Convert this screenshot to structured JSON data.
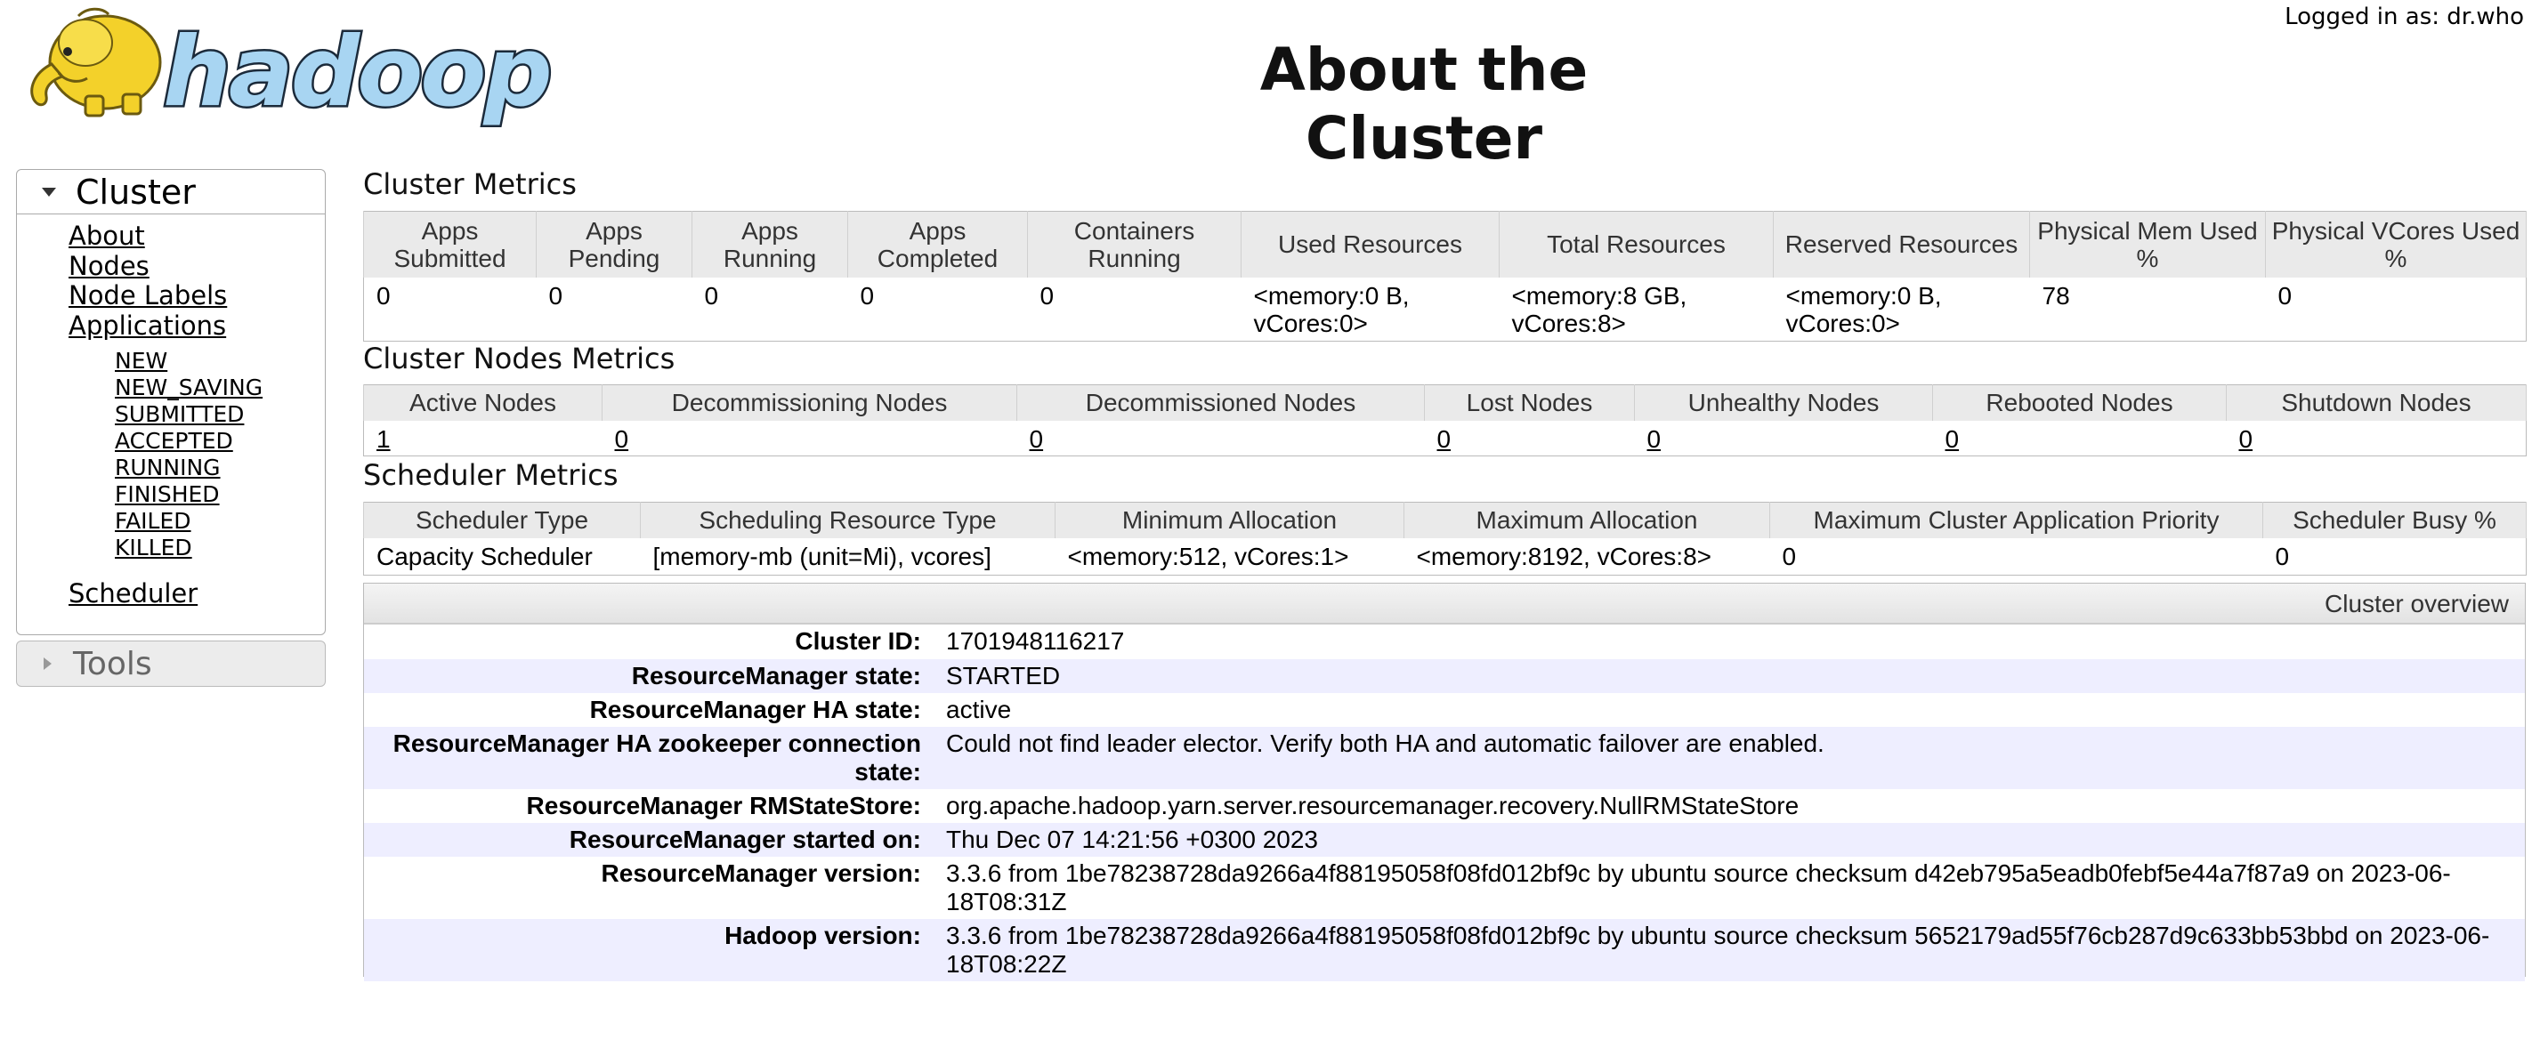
{
  "header": {
    "login_text": "Logged in as: dr.who",
    "page_title": "About the Cluster",
    "logo_text": "hadoop"
  },
  "sidebar": {
    "cluster_label": "Cluster",
    "links": [
      "About",
      "Nodes",
      "Node Labels",
      "Applications"
    ],
    "app_states": [
      "NEW",
      "NEW_SAVING",
      "SUBMITTED",
      "ACCEPTED",
      "RUNNING",
      "FINISHED",
      "FAILED",
      "KILLED"
    ],
    "scheduler_label": "Scheduler",
    "tools_label": "Tools"
  },
  "cluster_metrics": {
    "title": "Cluster Metrics",
    "headers": [
      "Apps Submitted",
      "Apps Pending",
      "Apps Running",
      "Apps Completed",
      "Containers Running",
      "Used Resources",
      "Total Resources",
      "Reserved Resources",
      "Physical Mem Used %",
      "Physical VCores Used %"
    ],
    "values": [
      "0",
      "0",
      "0",
      "0",
      "0",
      "<memory:0 B, vCores:0>",
      "<memory:8 GB, vCores:8>",
      "<memory:0 B, vCores:0>",
      "78",
      "0"
    ]
  },
  "node_metrics": {
    "title": "Cluster Nodes Metrics",
    "headers": [
      "Active Nodes",
      "Decommissioning Nodes",
      "Decommissioned Nodes",
      "Lost Nodes",
      "Unhealthy Nodes",
      "Rebooted Nodes",
      "Shutdown Nodes"
    ],
    "values": [
      "1",
      "0",
      "0",
      "0",
      "0",
      "0",
      "0"
    ]
  },
  "scheduler_metrics": {
    "title": "Scheduler Metrics",
    "headers": [
      "Scheduler Type",
      "Scheduling Resource Type",
      "Minimum Allocation",
      "Maximum Allocation",
      "Maximum Cluster Application Priority",
      "Scheduler Busy %"
    ],
    "values": [
      "Capacity Scheduler",
      "[memory-mb (unit=Mi), vcores]",
      "<memory:512, vCores:1>",
      "<memory:8192, vCores:8>",
      "0",
      "0"
    ]
  },
  "overview": {
    "title": "Cluster overview",
    "rows": [
      {
        "label": "Cluster ID:",
        "value": "1701948116217"
      },
      {
        "label": "ResourceManager state:",
        "value": "STARTED"
      },
      {
        "label": "ResourceManager HA state:",
        "value": "active"
      },
      {
        "label": "ResourceManager HA zookeeper connection state:",
        "value": "Could not find leader elector. Verify both HA and automatic failover are enabled."
      },
      {
        "label": "ResourceManager RMStateStore:",
        "value": "org.apache.hadoop.yarn.server.resourcemanager.recovery.NullRMStateStore"
      },
      {
        "label": "ResourceManager started on:",
        "value": "Thu Dec 07 14:21:56 +0300 2023"
      },
      {
        "label": "ResourceManager version:",
        "value": "3.3.6 from 1be78238728da9266a4f88195058f08fd012bf9c by ubuntu source checksum d42eb795a5eadb0febf5e44a7f87a9 on 2023-06-18T08:31Z"
      },
      {
        "label": "Hadoop version:",
        "value": "3.3.6 from 1be78238728da9266a4f88195058f08fd012bf9c by ubuntu source checksum 5652179ad55f76cb287d9c633bb53bbd on 2023-06-18T08:22Z"
      }
    ]
  },
  "colors": {
    "logo_elephant": "#f3d12a",
    "logo_text_fill": "#a8d5f2",
    "logo_text_stroke": "#1b2a3a",
    "overview_alt_row": "#eeeeff"
  }
}
